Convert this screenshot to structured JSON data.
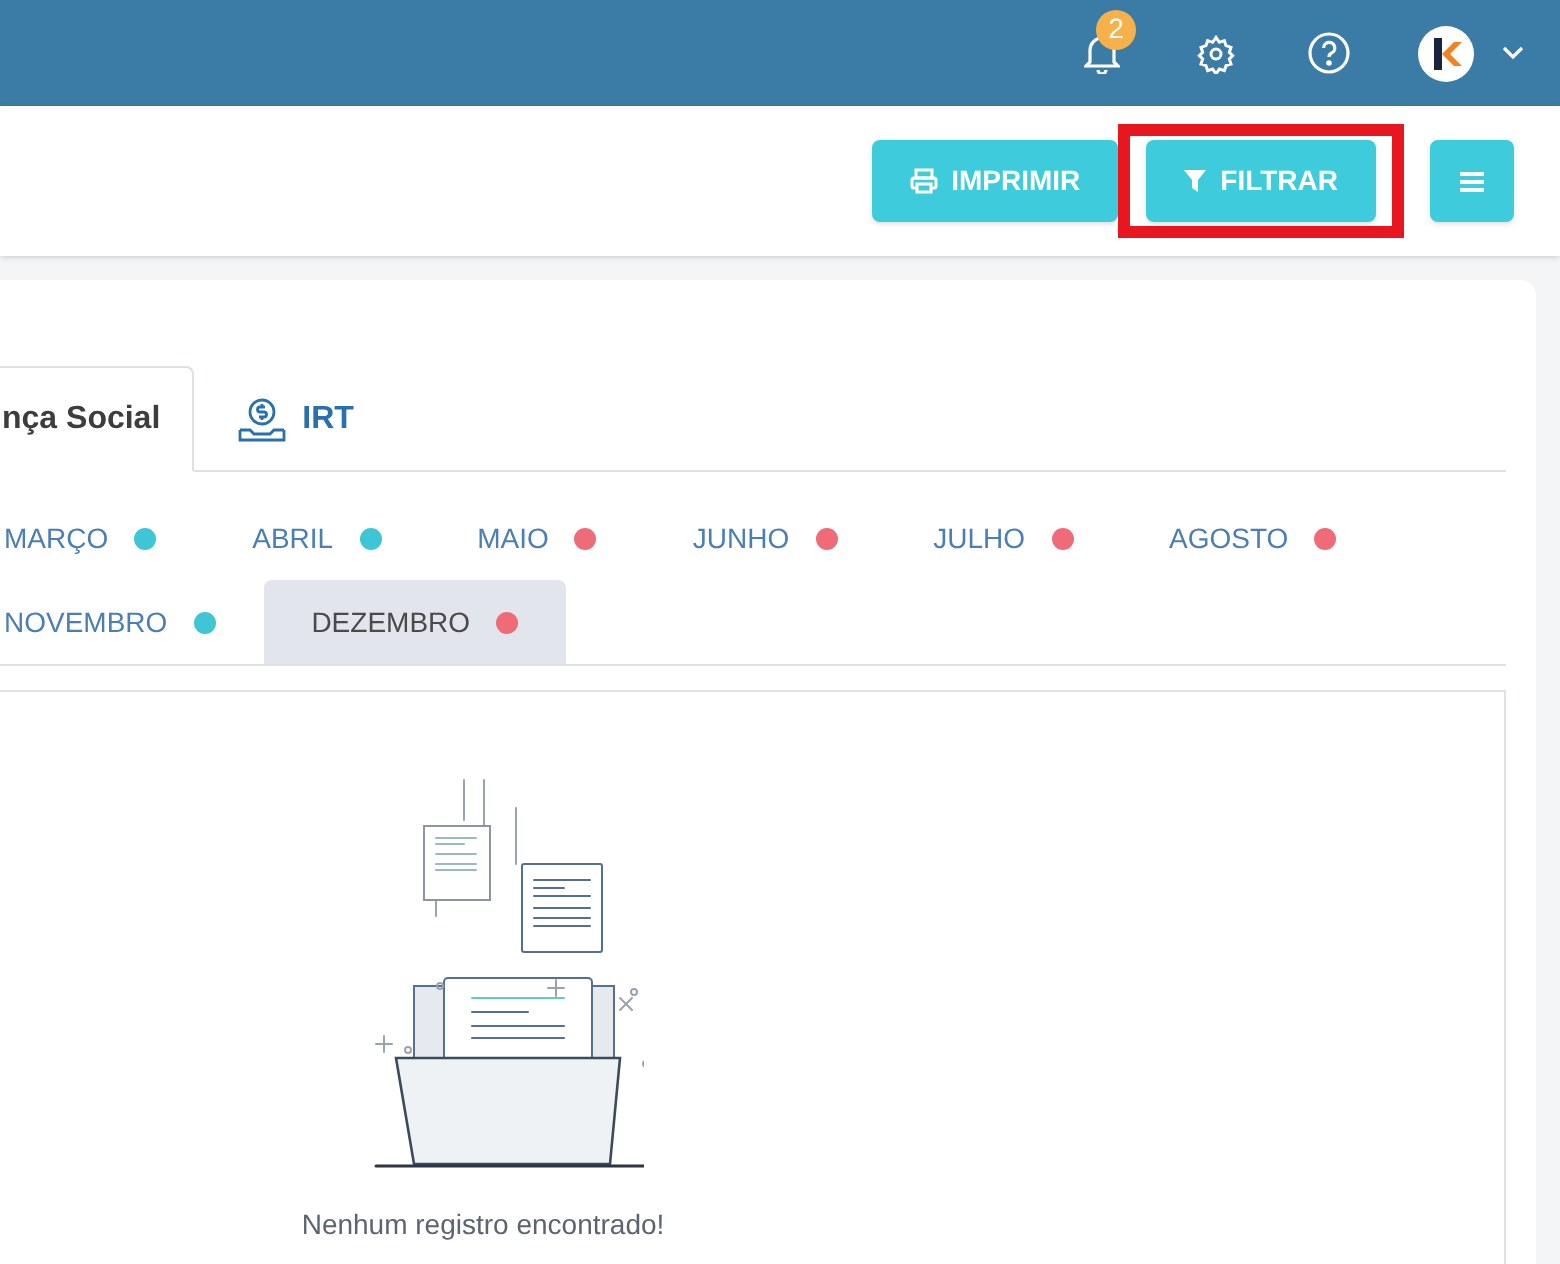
{
  "header": {
    "notifications": {
      "count": "2"
    }
  },
  "toolbar": {
    "buttons": [
      {
        "kind": "print",
        "label": "IMPRIMIR",
        "highlighted": false
      },
      {
        "kind": "filter",
        "label": "FILTRAR",
        "highlighted": true
      },
      {
        "kind": "menu",
        "highlighted": false
      }
    ]
  },
  "tabs": [
    {
      "label": "nça Social",
      "kind": "text",
      "selected": true
    },
    {
      "label": "IRT",
      "kind": "money",
      "selected": false
    }
  ],
  "months": [
    [
      {
        "label": "MARÇO",
        "color": "#3ec6d6",
        "selected": false
      },
      {
        "label": "ABRIL",
        "color": "#3ec6d6",
        "selected": false
      },
      {
        "label": "MAIO",
        "color": "#ee6b77",
        "selected": false
      },
      {
        "label": "JUNHO",
        "color": "#ee6b77",
        "selected": false
      },
      {
        "label": "JULHO",
        "color": "#ee6b77",
        "selected": false
      },
      {
        "label": "AGOSTO",
        "color": "#ee6b77",
        "selected": false
      }
    ],
    [
      {
        "label": "NOVEMBRO",
        "color": "#3ec6d6",
        "selected": false
      },
      {
        "label": "DEZEMBRO",
        "color": "#ee6b77",
        "selected": true
      }
    ]
  ],
  "empty_state": {
    "message": "Nenhum registro encontrado!"
  }
}
